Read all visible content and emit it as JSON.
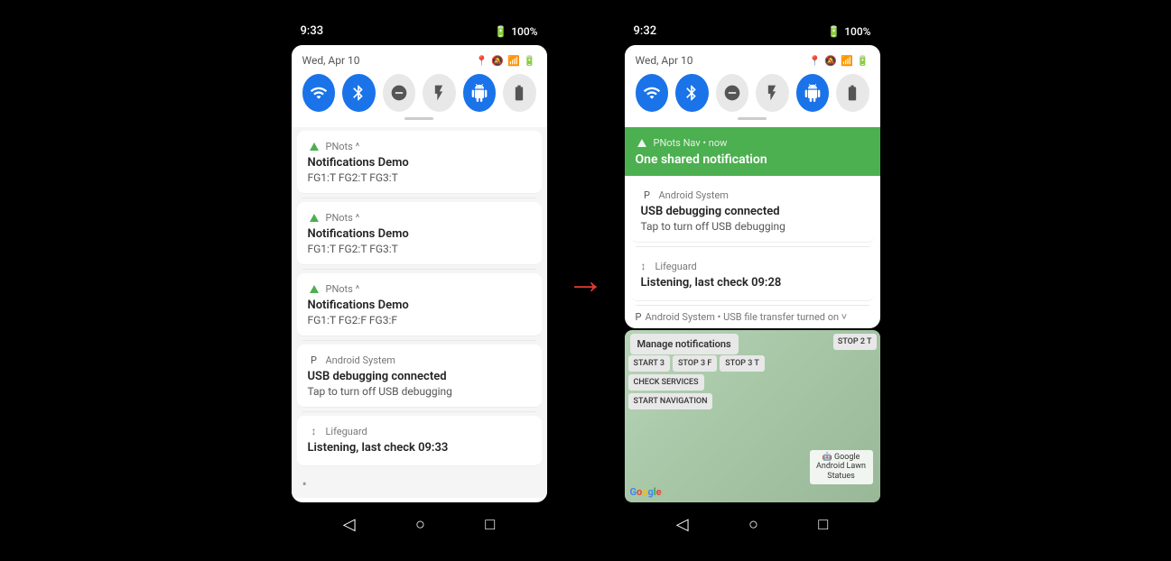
{
  "left_screen": {
    "status_bar": {
      "time": "9:33",
      "battery": "100%",
      "battery_icon": "🔋"
    },
    "quick_settings": {
      "date": "Wed, Apr 10",
      "icons": [
        "📍",
        "🔕",
        "📶",
        "△"
      ]
    },
    "toggles": [
      {
        "id": "wifi",
        "active": true,
        "icon": "wifi"
      },
      {
        "id": "bluetooth",
        "active": true,
        "icon": "bluetooth"
      },
      {
        "id": "dnd",
        "active": false,
        "icon": "dnd"
      },
      {
        "id": "flashlight",
        "active": false,
        "icon": "flashlight"
      },
      {
        "id": "android",
        "active": true,
        "icon": "android"
      },
      {
        "id": "battery",
        "active": false,
        "icon": "battery"
      }
    ],
    "notifications": [
      {
        "app": "PNots",
        "chevron": "^",
        "title": "Notifications Demo",
        "body": "FG1:T FG2:T FG3:T"
      },
      {
        "app": "PNots",
        "chevron": "^",
        "title": "Notifications Demo",
        "body": "FG1:T FG2:T FG3:T"
      },
      {
        "app": "PNots",
        "chevron": "^",
        "title": "Notifications Demo",
        "body": "FG1:T FG2:F FG3:F"
      },
      {
        "app": "Android System",
        "title": "USB debugging connected",
        "body": "Tap to turn off USB debugging"
      },
      {
        "app": "Lifeguard",
        "title": "Listening, last check 09:33"
      }
    ],
    "nav": {
      "back": "◁",
      "home": "○",
      "recents": "□"
    }
  },
  "right_screen": {
    "status_bar": {
      "time": "9:32",
      "battery": "100%",
      "battery_icon": "🔋"
    },
    "quick_settings": {
      "date": "Wed, Apr 10",
      "icons": [
        "📍",
        "🔕",
        "📶",
        "△"
      ]
    },
    "toggles": [
      {
        "id": "wifi",
        "active": true,
        "icon": "wifi"
      },
      {
        "id": "bluetooth",
        "active": true,
        "icon": "bluetooth"
      },
      {
        "id": "dnd",
        "active": false,
        "icon": "dnd"
      },
      {
        "id": "flashlight",
        "active": false,
        "icon": "flashlight"
      },
      {
        "id": "android",
        "active": true,
        "icon": "android"
      },
      {
        "id": "battery",
        "active": false,
        "icon": "battery"
      }
    ],
    "pnots_notification": {
      "app": "PNots Nav",
      "time": "now",
      "title": "One shared notification"
    },
    "notifications": [
      {
        "app": "Android System",
        "title": "USB debugging connected",
        "body": "Tap to turn off USB debugging"
      },
      {
        "app": "Lifeguard",
        "title": "Listening, last check 09:28"
      }
    ],
    "usb_footer": "Android System • USB file transfer turned on ˅",
    "manage_label": "Manage notifications",
    "action_buttons": [
      "START 3",
      "STOP 3 F",
      "STOP 3 T",
      "CHECK SERVICES",
      "",
      "",
      "START NAVIGATION",
      "",
      ""
    ],
    "action_buttons_row1": [
      "START 3",
      "STOP 3 F",
      "STOP 3 T"
    ],
    "action_buttons_row2": [
      "CHECK SERVICES",
      "",
      ""
    ],
    "action_buttons_row3": [
      "START NAVIGATION",
      "",
      ""
    ],
    "map_label": "Google Android Lawn Statues",
    "google_logo": "Google",
    "nav": {
      "back": "◁",
      "home": "○",
      "recents": "□"
    }
  },
  "arrow": "→"
}
